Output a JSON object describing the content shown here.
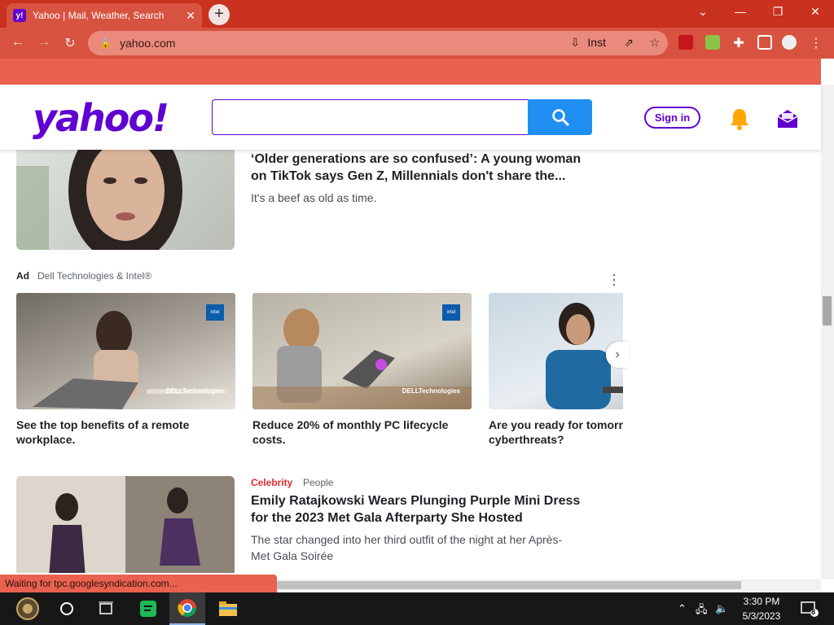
{
  "browser": {
    "tab_title": "Yahoo | Mail, Weather, Search",
    "tab_favicon": "y!",
    "url": "yahoo.com",
    "inst_label": "Inst",
    "new_tab_label": "+"
  },
  "header": {
    "logo": "yahoo!",
    "search_placeholder": "",
    "signin_label": "Sign in"
  },
  "stories": [
    {
      "title": "‘Older generations are so confused’: A young woman on TikTok says Gen Z, Millennials don't share the...",
      "summary": "It's a beef as old as time."
    },
    {
      "category": "Celebrity",
      "provider": "People",
      "title": "Emily Ratajkowski Wears Plunging Purple Mini Dress for the 2023 Met Gala Afterparty She Hosted",
      "summary": "The star changed into her third outfit of the night at her Après-Met Gala Soirée"
    }
  ],
  "ad": {
    "label": "Ad",
    "sponsor": "Dell Technologies & Intel®",
    "cards": [
      {
        "title": "See the top benefits of a remote workplace."
      },
      {
        "title": "Reduce 20% of monthly PC lifecycle costs."
      },
      {
        "title": "Are you ready for tomorrow's cyberthreats?"
      }
    ],
    "intel_badge": "intel",
    "dell_mark": "DELLTechnologies"
  },
  "status_text": "Waiting for tpc.googlesyndication.com...",
  "taskbar": {
    "time": "3:30 PM",
    "date": "5/3/2023",
    "notif_count": "8"
  },
  "colors": {
    "chrome_red": "#c8321e",
    "toolbar_red": "#d7533f",
    "yahoo_purple": "#6001d2",
    "search_blue": "#1f8ff2",
    "category_red": "#e0292f"
  }
}
